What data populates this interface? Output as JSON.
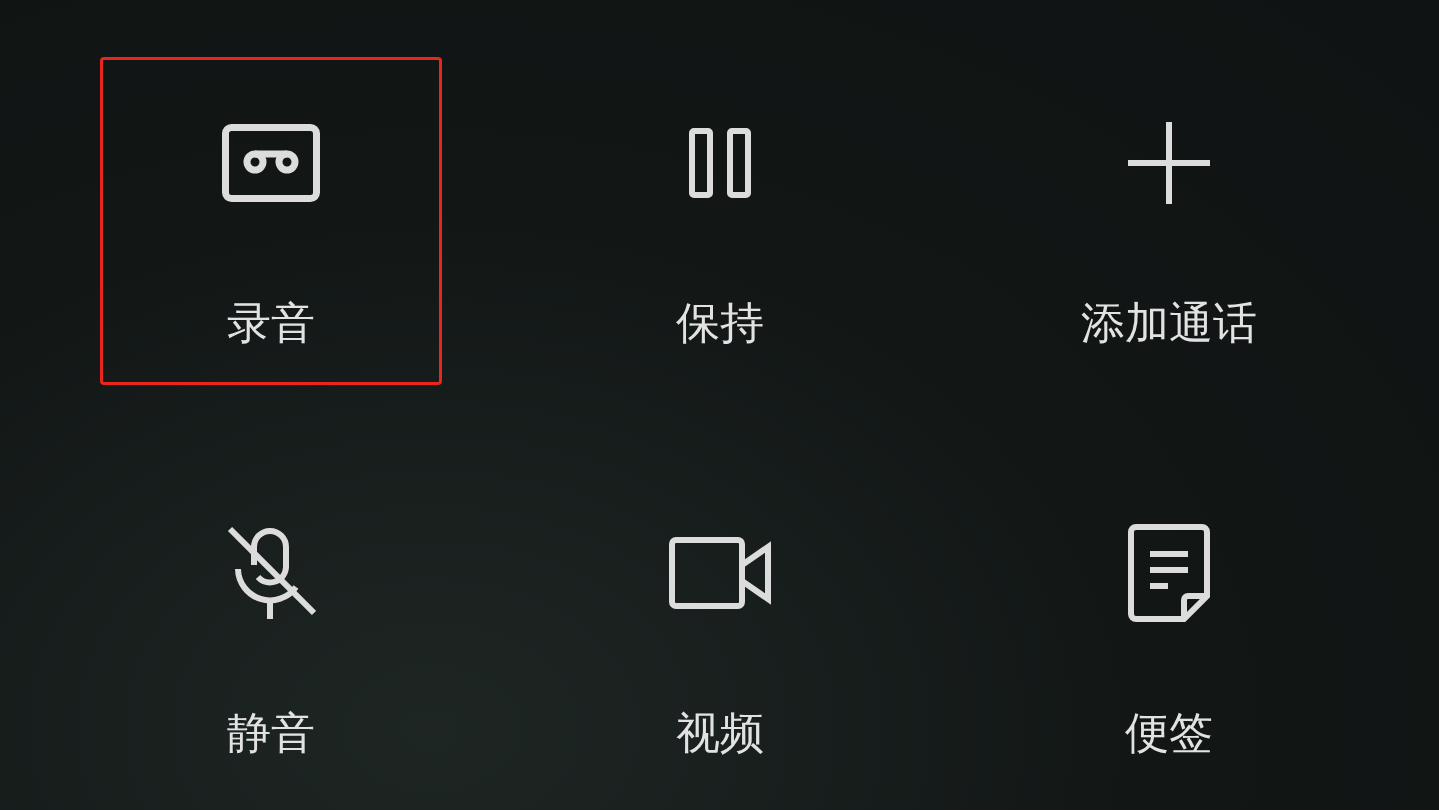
{
  "actions": [
    {
      "label": "录音",
      "kind": "record",
      "selected": true
    },
    {
      "label": "保持",
      "kind": "hold",
      "selected": false
    },
    {
      "label": "添加通话",
      "kind": "add",
      "selected": false
    },
    {
      "label": "静音",
      "kind": "mute",
      "selected": false
    },
    {
      "label": "视频",
      "kind": "video",
      "selected": false
    },
    {
      "label": "便签",
      "kind": "note",
      "selected": false
    }
  ]
}
